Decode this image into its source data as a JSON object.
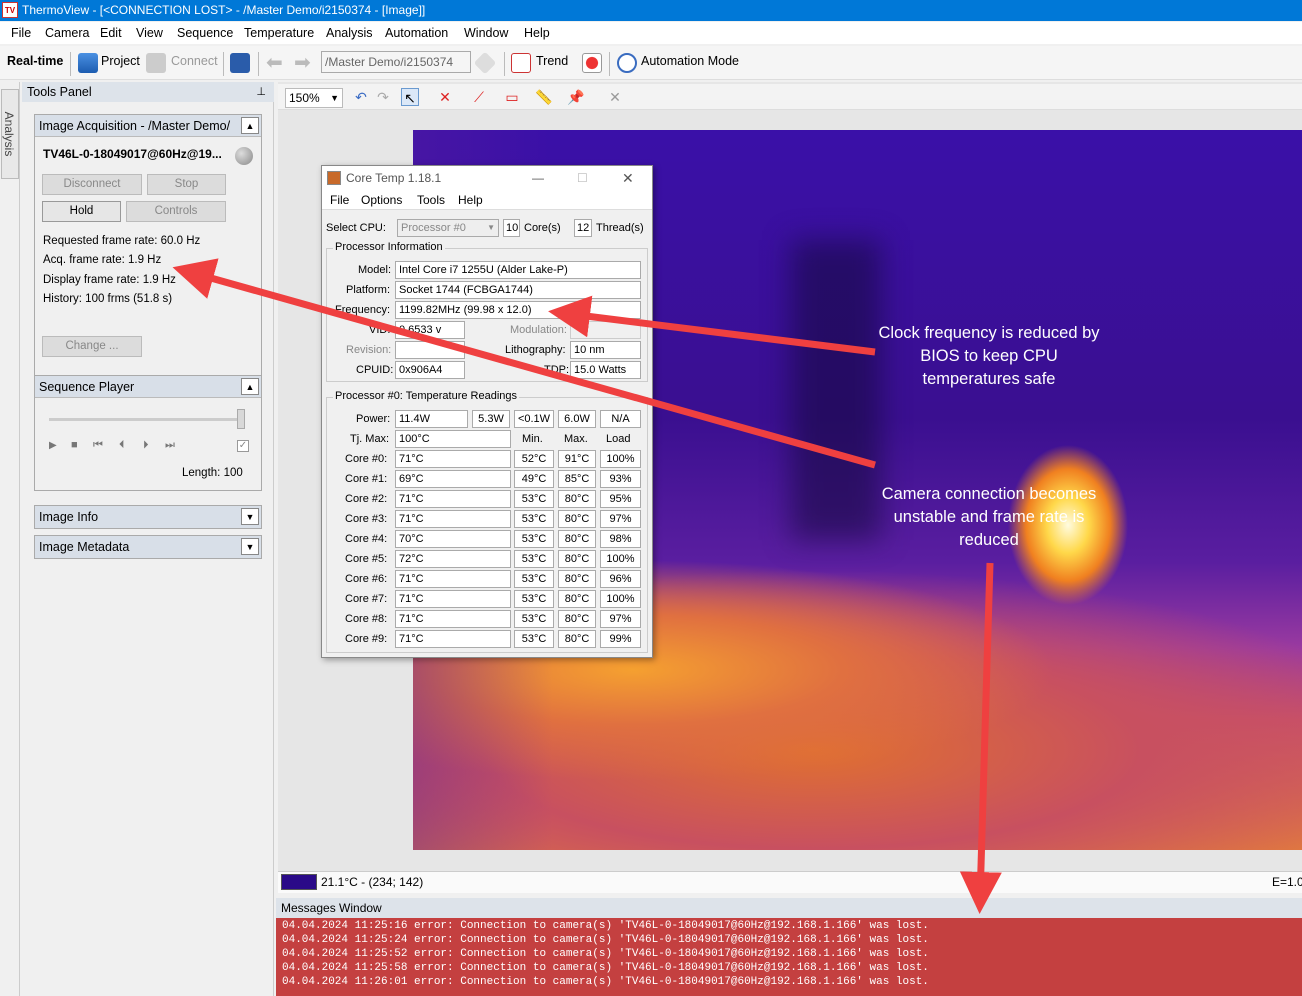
{
  "window": {
    "title": "ThermoView - [<CONNECTION LOST> - /Master Demo/i2150374 - [Image]]",
    "app_icon": "TV"
  },
  "menu": [
    "File",
    "Camera",
    "Edit",
    "View",
    "Sequence",
    "Temperature",
    "Analysis",
    "Automation",
    "Window",
    "Help"
  ],
  "toolbar": {
    "realtime": "Real-time",
    "project": "Project",
    "connect": "Connect",
    "path": "/Master Demo/i2150374",
    "trend": "Trend",
    "automation": "Automation Mode"
  },
  "side_tab": "Analysis Objects",
  "tools_panel": {
    "title": "Tools Panel",
    "acq": {
      "title": "Image Acquisition - /Master Demo/",
      "camera": "TV46L-0-18049017@60Hz@19...",
      "disconnect": "Disconnect",
      "stop": "Stop",
      "hold": "Hold",
      "controls": "Controls",
      "requested": "Requested frame rate: 60.0 Hz",
      "acq_rate": "Acq. frame rate: 1.9 Hz",
      "display": "Display frame rate: 1.9 Hz",
      "history": "History: 100 frms (51.8 s)",
      "change": "Change ..."
    },
    "seq": {
      "title": "Sequence Player",
      "length": "Length: 100"
    },
    "info": "Image Info",
    "meta": "Image Metadata"
  },
  "image": {
    "zoom": "150%",
    "status_temp": "21.1°C - (234; 142)",
    "status_e": "E=1.0"
  },
  "messages": {
    "title": "Messages Window",
    "lines": [
      "04.04.2024 11:25:16 error: Connection to camera(s) 'TV46L-0-18049017@60Hz@192.168.1.166' was lost.",
      "04.04.2024 11:25:24 error: Connection to camera(s) 'TV46L-0-18049017@60Hz@192.168.1.166' was lost.",
      "04.04.2024 11:25:52 error: Connection to camera(s) 'TV46L-0-18049017@60Hz@192.168.1.166' was lost.",
      "04.04.2024 11:25:58 error: Connection to camera(s) 'TV46L-0-18049017@60Hz@192.168.1.166' was lost.",
      "04.04.2024 11:26:01 error: Connection to camera(s) 'TV46L-0-18049017@60Hz@192.168.1.166' was lost."
    ]
  },
  "coretemp": {
    "title": "Core Temp 1.18.1",
    "menu": [
      "File",
      "Options",
      "Tools",
      "Help"
    ],
    "select_cpu": "Select CPU:",
    "processor": "Processor #0",
    "cores": "10",
    "cores_lbl": "Core(s)",
    "threads": "12",
    "threads_lbl": "Thread(s)",
    "proc_info": "Processor Information",
    "model_lbl": "Model:",
    "model": "Intel Core i7 1255U (Alder Lake-P)",
    "platform_lbl": "Platform:",
    "platform": "Socket 1744 (FCBGA1744)",
    "freq_lbl": "Frequency:",
    "freq": "1199.82MHz (99.98 x 12.0)",
    "vid_lbl": "VID:",
    "vid": "0.6533 v",
    "mod_lbl": "Modulation:",
    "rev_lbl": "Revision:",
    "litho_lbl": "Lithography:",
    "litho": "10 nm",
    "cpuid_lbl": "CPUID:",
    "cpuid": "0x906A4",
    "tdp_lbl": "TDP:",
    "tdp": "15.0 Watts",
    "temp_title": "Processor #0: Temperature Readings",
    "power_lbl": "Power:",
    "power": [
      "11.4W",
      "5.3W",
      "<0.1W",
      "6.0W",
      "N/A"
    ],
    "tjmax_lbl": "Tj. Max:",
    "tjmax": "100°C",
    "col_min": "Min.",
    "col_max": "Max.",
    "col_load": "Load",
    "cores_rows": [
      {
        "name": "Core #0:",
        "t": "71°C",
        "min": "52°C",
        "max": "91°C",
        "load": "100%"
      },
      {
        "name": "Core #1:",
        "t": "69°C",
        "min": "49°C",
        "max": "85°C",
        "load": "93%"
      },
      {
        "name": "Core #2:",
        "t": "71°C",
        "min": "53°C",
        "max": "80°C",
        "load": "95%"
      },
      {
        "name": "Core #3:",
        "t": "71°C",
        "min": "53°C",
        "max": "80°C",
        "load": "97%"
      },
      {
        "name": "Core #4:",
        "t": "70°C",
        "min": "53°C",
        "max": "80°C",
        "load": "98%"
      },
      {
        "name": "Core #5:",
        "t": "72°C",
        "min": "53°C",
        "max": "80°C",
        "load": "100%"
      },
      {
        "name": "Core #6:",
        "t": "71°C",
        "min": "53°C",
        "max": "80°C",
        "load": "96%"
      },
      {
        "name": "Core #7:",
        "t": "71°C",
        "min": "53°C",
        "max": "80°C",
        "load": "100%"
      },
      {
        "name": "Core #8:",
        "t": "71°C",
        "min": "53°C",
        "max": "80°C",
        "load": "97%"
      },
      {
        "name": "Core #9:",
        "t": "71°C",
        "min": "53°C",
        "max": "80°C",
        "load": "99%"
      }
    ]
  },
  "annotations": {
    "clock": [
      "Clock frequency is reduced by",
      "BIOS to keep CPU",
      "temperatures safe"
    ],
    "camera": [
      "Camera connection becomes",
      "unstable and frame rate is",
      "reduced"
    ]
  },
  "colors": {
    "arrow": "#ef4040",
    "msg_bg": "#c44040",
    "titlebar": "#0078d7"
  }
}
